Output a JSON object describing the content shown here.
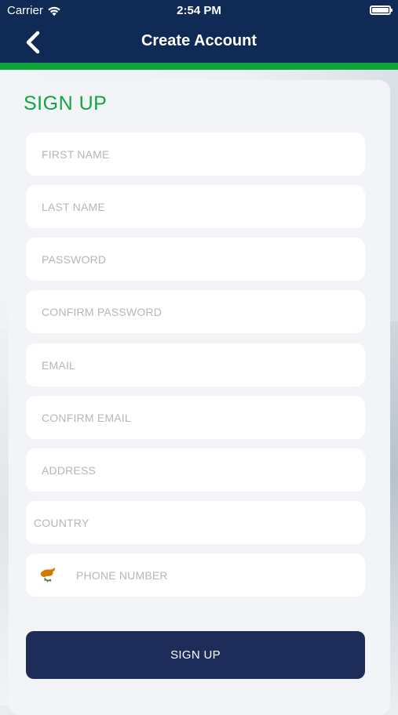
{
  "status_bar": {
    "carrier": "Carrier",
    "time": "2:54 PM"
  },
  "nav": {
    "back_icon": "chevron-left-icon",
    "title": "Create Account"
  },
  "colors": {
    "header_background": "#0e2a55",
    "accent_green": "#0fa33a",
    "title_green": "#12a543",
    "button_background": "#1e2c59",
    "card_background": "#f2f4f8",
    "placeholder": "#b3b7bd"
  },
  "form": {
    "title": "SIGN UP",
    "fields": {
      "first_name": {
        "placeholder": "FIRST NAME",
        "value": ""
      },
      "last_name": {
        "placeholder": "LAST NAME",
        "value": ""
      },
      "password": {
        "placeholder": "PASSWORD",
        "value": ""
      },
      "confirm_password": {
        "placeholder": "CONFIRM PASSWORD",
        "value": ""
      },
      "email": {
        "placeholder": "EMAIL",
        "value": ""
      },
      "confirm_email": {
        "placeholder": "CONFIRM EMAIL",
        "value": ""
      },
      "address": {
        "placeholder": "ADDRESS",
        "value": ""
      },
      "country": {
        "placeholder": "COUNTRY",
        "value": ""
      },
      "phone_number": {
        "placeholder": "PHONE NUMBER",
        "value": "",
        "flag_icon": "cyprus-flag-icon"
      }
    },
    "submit_label": "SIGN UP"
  }
}
